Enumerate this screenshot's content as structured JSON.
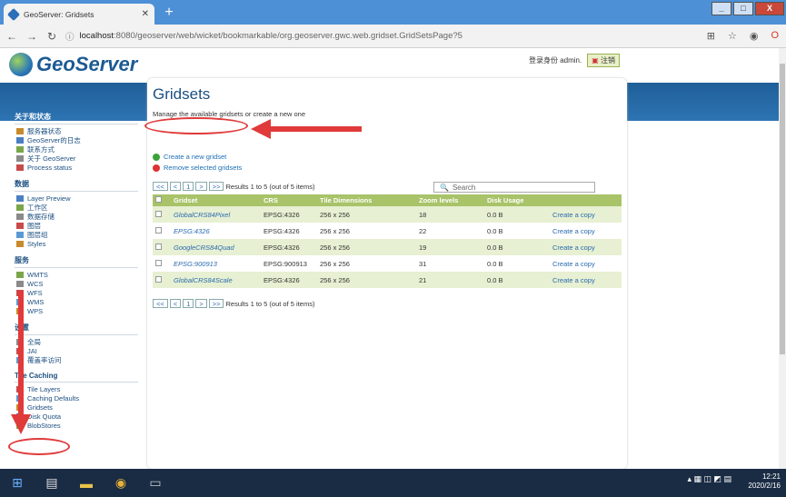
{
  "browser": {
    "tab_title": "GeoServer: Gridsets",
    "url_host": "localhost",
    "url_rest": ":8080/geoserver/web/wicket/bookmarkable/org.geoserver.gwc.web.gridset.GridSetsPage?5"
  },
  "header": {
    "logo_text": "GeoServer",
    "login_text": "登录身份 admin.",
    "logout_label": "注销"
  },
  "sidebar": {
    "sections": [
      {
        "title": "关于和状态",
        "items": [
          "服务器状态",
          "GeoServer的日志",
          "联系方式",
          "关于 GeoServer",
          "Process status"
        ]
      },
      {
        "title": "数据",
        "items": [
          "Layer Preview",
          "工作区",
          "数据存储",
          "图层",
          "图层组",
          "Styles"
        ]
      },
      {
        "title": "服务",
        "items": [
          "WMTS",
          "WCS",
          "WFS",
          "WMS",
          "WPS"
        ]
      },
      {
        "title": "设置",
        "items": [
          "全局",
          "JAI",
          "覆盖率访问"
        ]
      },
      {
        "title": "Tile Caching",
        "items": [
          "Tile Layers",
          "Caching Defaults",
          "Gridsets",
          "Disk Quota",
          "BlobStores"
        ]
      }
    ]
  },
  "main": {
    "title": "Gridsets",
    "description": "Manage the available gridsets or create a new one",
    "create_label": "Create a new gridset",
    "remove_label": "Remove selected gridsets",
    "pager": {
      "first": "<<",
      "prev": "<",
      "page": "1",
      "next": ">",
      "last": ">>",
      "results": "Results 1 to 5 (out of 5 items)"
    },
    "search_placeholder": "Search",
    "columns": [
      "Gridset",
      "CRS",
      "Tile Dimensions",
      "Zoom levels",
      "Disk Usage"
    ],
    "rows": [
      {
        "gridset": "GlobalCRS84Pixel",
        "crs": "EPSG:4326",
        "tile": "256 x 256",
        "zoom": "18",
        "disk": "0.0 B",
        "action": "Create a copy"
      },
      {
        "gridset": "EPSG:4326",
        "crs": "EPSG:4326",
        "tile": "256 x 256",
        "zoom": "22",
        "disk": "0.0 B",
        "action": "Create a copy"
      },
      {
        "gridset": "GoogleCRS84Quad",
        "crs": "EPSG:4326",
        "tile": "256 x 256",
        "zoom": "19",
        "disk": "0.0 B",
        "action": "Create a copy"
      },
      {
        "gridset": "EPSG:900913",
        "crs": "EPSG:900913",
        "tile": "256 x 256",
        "zoom": "31",
        "disk": "0.0 B",
        "action": "Create a copy"
      },
      {
        "gridset": "GlobalCRS84Scale",
        "crs": "EPSG:4326",
        "tile": "256 x 256",
        "zoom": "21",
        "disk": "0.0 B",
        "action": "Create a copy"
      }
    ]
  },
  "taskbar": {
    "time": "12:21",
    "date": "2020/2/16"
  },
  "colors": {
    "accent": "#1c4f80",
    "header_band": "#2d74b3",
    "table_head": "#a8c368",
    "annotation": "#e03a3a"
  }
}
